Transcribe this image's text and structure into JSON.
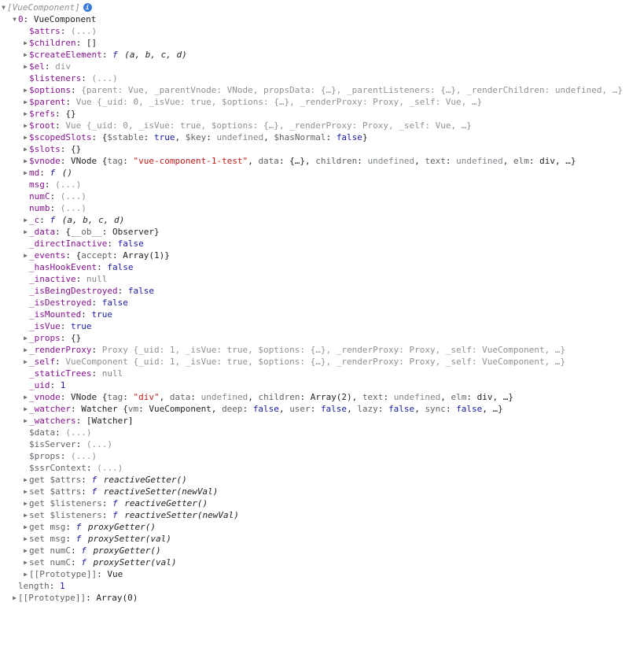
{
  "colors": {
    "key": "#881391",
    "num": "#1a1aa6",
    "str": "#c41a16",
    "undef": "#80868b",
    "dim": "#919191"
  },
  "lines": [
    {
      "indent": 0,
      "arrow": "down",
      "parts": [
        {
          "t": "italic v-dim",
          "v": "[VueComponent]"
        }
      ],
      "info": true
    },
    {
      "indent": 1,
      "arrow": "down",
      "parts": [
        {
          "t": "key",
          "v": "0"
        },
        {
          "t": "",
          "v": ": "
        },
        {
          "t": "cls",
          "v": "VueComponent"
        }
      ]
    },
    {
      "indent": 2,
      "arrow": "none",
      "parts": [
        {
          "t": "key",
          "v": "$attrs"
        },
        {
          "t": "",
          "v": ": "
        },
        {
          "t": "v-dim",
          "v": "(...)"
        }
      ]
    },
    {
      "indent": 2,
      "arrow": "right",
      "parts": [
        {
          "t": "key",
          "v": "$children"
        },
        {
          "t": "",
          "v": ": "
        },
        {
          "t": "cls",
          "v": "[]"
        }
      ]
    },
    {
      "indent": 2,
      "arrow": "right",
      "parts": [
        {
          "t": "key",
          "v": "$createElement"
        },
        {
          "t": "",
          "v": ": "
        },
        {
          "t": "f-letter",
          "v": "f"
        },
        {
          "t": "v-fn",
          "v": " (a, b, c, d)"
        }
      ]
    },
    {
      "indent": 2,
      "arrow": "right",
      "parts": [
        {
          "t": "key",
          "v": "$el"
        },
        {
          "t": "",
          "v": ": "
        },
        {
          "t": "v-dim",
          "v": "div"
        }
      ]
    },
    {
      "indent": 2,
      "arrow": "none",
      "parts": [
        {
          "t": "key",
          "v": "$listeners"
        },
        {
          "t": "",
          "v": ": "
        },
        {
          "t": "v-dim",
          "v": "(...)"
        }
      ]
    },
    {
      "indent": 2,
      "arrow": "right",
      "parts": [
        {
          "t": "key",
          "v": "$options"
        },
        {
          "t": "",
          "v": ": "
        },
        {
          "t": "v-dim",
          "v": "{parent: Vue, _parentVnode: VNode, propsData: {…}, _parentListeners: {…}, _renderChildren: undefined, …}"
        }
      ]
    },
    {
      "indent": 2,
      "arrow": "right",
      "parts": [
        {
          "t": "key",
          "v": "$parent"
        },
        {
          "t": "",
          "v": ": "
        },
        {
          "t": "v-dim",
          "v": "Vue {_uid: 0, _isVue: true, $options: {…}, _renderProxy: Proxy, _self: Vue, …}"
        }
      ]
    },
    {
      "indent": 2,
      "arrow": "right",
      "parts": [
        {
          "t": "key",
          "v": "$refs"
        },
        {
          "t": "",
          "v": ": "
        },
        {
          "t": "cls",
          "v": "{}"
        }
      ]
    },
    {
      "indent": 2,
      "arrow": "right",
      "parts": [
        {
          "t": "key",
          "v": "$root"
        },
        {
          "t": "",
          "v": ": "
        },
        {
          "t": "v-dim",
          "v": "Vue {_uid: 0, _isVue: true, $options: {…}, _renderProxy: Proxy, _self: Vue, …}"
        }
      ]
    },
    {
      "indent": 2,
      "arrow": "right",
      "parts": [
        {
          "t": "key",
          "v": "$scopedSlots"
        },
        {
          "t": "",
          "v": ": "
        },
        {
          "t": "brace",
          "v": "{"
        },
        {
          "t": "k-dim",
          "v": "$stable"
        },
        {
          "t": "",
          "v": ": "
        },
        {
          "t": "v-num",
          "v": "true"
        },
        {
          "t": "",
          "v": ", "
        },
        {
          "t": "k-dim",
          "v": "$key"
        },
        {
          "t": "",
          "v": ": "
        },
        {
          "t": "v-undef",
          "v": "undefined"
        },
        {
          "t": "",
          "v": ", "
        },
        {
          "t": "k-dim",
          "v": "$hasNormal"
        },
        {
          "t": "",
          "v": ": "
        },
        {
          "t": "v-num",
          "v": "false"
        },
        {
          "t": "brace",
          "v": "}"
        }
      ]
    },
    {
      "indent": 2,
      "arrow": "right",
      "parts": [
        {
          "t": "key",
          "v": "$slots"
        },
        {
          "t": "",
          "v": ": "
        },
        {
          "t": "cls",
          "v": "{}"
        }
      ]
    },
    {
      "indent": 2,
      "arrow": "right",
      "parts": [
        {
          "t": "key",
          "v": "$vnode"
        },
        {
          "t": "",
          "v": ": "
        },
        {
          "t": "cls",
          "v": "VNode {"
        },
        {
          "t": "k-dim",
          "v": "tag"
        },
        {
          "t": "",
          "v": ": "
        },
        {
          "t": "v-str",
          "v": "\"vue-component-1-test\""
        },
        {
          "t": "",
          "v": ", "
        },
        {
          "t": "k-dim",
          "v": "data"
        },
        {
          "t": "",
          "v": ": {…}, "
        },
        {
          "t": "k-dim",
          "v": "children"
        },
        {
          "t": "",
          "v": ": "
        },
        {
          "t": "v-undef",
          "v": "undefined"
        },
        {
          "t": "",
          "v": ", "
        },
        {
          "t": "k-dim",
          "v": "text"
        },
        {
          "t": "",
          "v": ": "
        },
        {
          "t": "v-undef",
          "v": "undefined"
        },
        {
          "t": "",
          "v": ", "
        },
        {
          "t": "k-dim",
          "v": "elm"
        },
        {
          "t": "",
          "v": ": div, …}"
        }
      ]
    },
    {
      "indent": 2,
      "arrow": "right",
      "parts": [
        {
          "t": "key",
          "v": "md"
        },
        {
          "t": "",
          "v": ": "
        },
        {
          "t": "f-letter",
          "v": "f"
        },
        {
          "t": "v-fn",
          "v": " ()"
        }
      ]
    },
    {
      "indent": 2,
      "arrow": "none",
      "parts": [
        {
          "t": "key",
          "v": "msg"
        },
        {
          "t": "",
          "v": ": "
        },
        {
          "t": "v-dim",
          "v": "(...)"
        }
      ]
    },
    {
      "indent": 2,
      "arrow": "none",
      "parts": [
        {
          "t": "key",
          "v": "numC"
        },
        {
          "t": "",
          "v": ": "
        },
        {
          "t": "v-dim",
          "v": "(...)"
        }
      ]
    },
    {
      "indent": 2,
      "arrow": "none",
      "parts": [
        {
          "t": "key",
          "v": "numb"
        },
        {
          "t": "",
          "v": ": "
        },
        {
          "t": "v-dim",
          "v": "(...)"
        }
      ]
    },
    {
      "indent": 2,
      "arrow": "right",
      "parts": [
        {
          "t": "key",
          "v": "_c"
        },
        {
          "t": "",
          "v": ": "
        },
        {
          "t": "f-letter",
          "v": "f"
        },
        {
          "t": "v-fn",
          "v": " (a, b, c, d)"
        }
      ]
    },
    {
      "indent": 2,
      "arrow": "right",
      "parts": [
        {
          "t": "key",
          "v": "_data"
        },
        {
          "t": "",
          "v": ": "
        },
        {
          "t": "brace",
          "v": "{"
        },
        {
          "t": "k-dim",
          "v": "__ob__"
        },
        {
          "t": "",
          "v": ": Observer"
        },
        {
          "t": "brace",
          "v": "}"
        }
      ]
    },
    {
      "indent": 2,
      "arrow": "none",
      "parts": [
        {
          "t": "key",
          "v": "_directInactive"
        },
        {
          "t": "",
          "v": ": "
        },
        {
          "t": "v-num",
          "v": "false"
        }
      ]
    },
    {
      "indent": 2,
      "arrow": "right",
      "parts": [
        {
          "t": "key",
          "v": "_events"
        },
        {
          "t": "",
          "v": ": "
        },
        {
          "t": "brace",
          "v": "{"
        },
        {
          "t": "k-dim",
          "v": "accept"
        },
        {
          "t": "",
          "v": ": Array(1)"
        },
        {
          "t": "brace",
          "v": "}"
        }
      ]
    },
    {
      "indent": 2,
      "arrow": "none",
      "parts": [
        {
          "t": "key",
          "v": "_hasHookEvent"
        },
        {
          "t": "",
          "v": ": "
        },
        {
          "t": "v-num",
          "v": "false"
        }
      ]
    },
    {
      "indent": 2,
      "arrow": "none",
      "parts": [
        {
          "t": "key",
          "v": "_inactive"
        },
        {
          "t": "",
          "v": ": "
        },
        {
          "t": "v-undef",
          "v": "null"
        }
      ]
    },
    {
      "indent": 2,
      "arrow": "none",
      "parts": [
        {
          "t": "key",
          "v": "_isBeingDestroyed"
        },
        {
          "t": "",
          "v": ": "
        },
        {
          "t": "v-num",
          "v": "false"
        }
      ]
    },
    {
      "indent": 2,
      "arrow": "none",
      "parts": [
        {
          "t": "key",
          "v": "_isDestroyed"
        },
        {
          "t": "",
          "v": ": "
        },
        {
          "t": "v-num",
          "v": "false"
        }
      ]
    },
    {
      "indent": 2,
      "arrow": "none",
      "parts": [
        {
          "t": "key",
          "v": "_isMounted"
        },
        {
          "t": "",
          "v": ": "
        },
        {
          "t": "v-num",
          "v": "true"
        }
      ]
    },
    {
      "indent": 2,
      "arrow": "none",
      "parts": [
        {
          "t": "key",
          "v": "_isVue"
        },
        {
          "t": "",
          "v": ": "
        },
        {
          "t": "v-num",
          "v": "true"
        }
      ]
    },
    {
      "indent": 2,
      "arrow": "right",
      "parts": [
        {
          "t": "key",
          "v": "_props"
        },
        {
          "t": "",
          "v": ": "
        },
        {
          "t": "cls",
          "v": "{}"
        }
      ]
    },
    {
      "indent": 2,
      "arrow": "right",
      "parts": [
        {
          "t": "key",
          "v": "_renderProxy"
        },
        {
          "t": "",
          "v": ": "
        },
        {
          "t": "v-dim",
          "v": "Proxy {_uid: 1, _isVue: true, $options: {…}, _renderProxy: Proxy, _self: VueComponent, …}"
        }
      ]
    },
    {
      "indent": 2,
      "arrow": "right",
      "parts": [
        {
          "t": "key",
          "v": "_self"
        },
        {
          "t": "",
          "v": ": "
        },
        {
          "t": "v-dim",
          "v": "VueComponent {_uid: 1, _isVue: true, $options: {…}, _renderProxy: Proxy, _self: VueComponent, …}"
        }
      ]
    },
    {
      "indent": 2,
      "arrow": "none",
      "parts": [
        {
          "t": "key",
          "v": "_staticTrees"
        },
        {
          "t": "",
          "v": ": "
        },
        {
          "t": "v-undef",
          "v": "null"
        }
      ]
    },
    {
      "indent": 2,
      "arrow": "none",
      "parts": [
        {
          "t": "key",
          "v": "_uid"
        },
        {
          "t": "",
          "v": ": "
        },
        {
          "t": "v-num",
          "v": "1"
        }
      ]
    },
    {
      "indent": 2,
      "arrow": "right",
      "parts": [
        {
          "t": "key",
          "v": "_vnode"
        },
        {
          "t": "",
          "v": ": "
        },
        {
          "t": "cls",
          "v": "VNode {"
        },
        {
          "t": "k-dim",
          "v": "tag"
        },
        {
          "t": "",
          "v": ": "
        },
        {
          "t": "v-str",
          "v": "\"div\""
        },
        {
          "t": "",
          "v": ", "
        },
        {
          "t": "k-dim",
          "v": "data"
        },
        {
          "t": "",
          "v": ": "
        },
        {
          "t": "v-undef",
          "v": "undefined"
        },
        {
          "t": "",
          "v": ", "
        },
        {
          "t": "k-dim",
          "v": "children"
        },
        {
          "t": "",
          "v": ": Array(2), "
        },
        {
          "t": "k-dim",
          "v": "text"
        },
        {
          "t": "",
          "v": ": "
        },
        {
          "t": "v-undef",
          "v": "undefined"
        },
        {
          "t": "",
          "v": ", "
        },
        {
          "t": "k-dim",
          "v": "elm"
        },
        {
          "t": "",
          "v": ": div, …}"
        }
      ]
    },
    {
      "indent": 2,
      "arrow": "right",
      "parts": [
        {
          "t": "key",
          "v": "_watcher"
        },
        {
          "t": "",
          "v": ": "
        },
        {
          "t": "cls",
          "v": "Watcher {"
        },
        {
          "t": "k-dim",
          "v": "vm"
        },
        {
          "t": "",
          "v": ": VueComponent, "
        },
        {
          "t": "k-dim",
          "v": "deep"
        },
        {
          "t": "",
          "v": ": "
        },
        {
          "t": "v-num",
          "v": "false"
        },
        {
          "t": "",
          "v": ", "
        },
        {
          "t": "k-dim",
          "v": "user"
        },
        {
          "t": "",
          "v": ": "
        },
        {
          "t": "v-num",
          "v": "false"
        },
        {
          "t": "",
          "v": ", "
        },
        {
          "t": "k-dim",
          "v": "lazy"
        },
        {
          "t": "",
          "v": ": "
        },
        {
          "t": "v-num",
          "v": "false"
        },
        {
          "t": "",
          "v": ", "
        },
        {
          "t": "k-dim",
          "v": "sync"
        },
        {
          "t": "",
          "v": ": "
        },
        {
          "t": "v-num",
          "v": "false"
        },
        {
          "t": "",
          "v": ", …}"
        }
      ]
    },
    {
      "indent": 2,
      "arrow": "right",
      "parts": [
        {
          "t": "key",
          "v": "_watchers"
        },
        {
          "t": "",
          "v": ": "
        },
        {
          "t": "cls",
          "v": "[Watcher]"
        }
      ]
    },
    {
      "indent": 2,
      "arrow": "none",
      "parts": [
        {
          "t": "k-dim",
          "v": "$data"
        },
        {
          "t": "",
          "v": ": "
        },
        {
          "t": "v-dim",
          "v": "(...)"
        }
      ]
    },
    {
      "indent": 2,
      "arrow": "none",
      "parts": [
        {
          "t": "k-dim",
          "v": "$isServer"
        },
        {
          "t": "",
          "v": ": "
        },
        {
          "t": "v-dim",
          "v": "(...)"
        }
      ]
    },
    {
      "indent": 2,
      "arrow": "none",
      "parts": [
        {
          "t": "k-dim",
          "v": "$props"
        },
        {
          "t": "",
          "v": ": "
        },
        {
          "t": "v-dim",
          "v": "(...)"
        }
      ]
    },
    {
      "indent": 2,
      "arrow": "none",
      "parts": [
        {
          "t": "k-dim",
          "v": "$ssrContext"
        },
        {
          "t": "",
          "v": ": "
        },
        {
          "t": "v-dim",
          "v": "(...)"
        }
      ]
    },
    {
      "indent": 2,
      "arrow": "right",
      "parts": [
        {
          "t": "k-dim",
          "v": "get $attrs"
        },
        {
          "t": "",
          "v": ": "
        },
        {
          "t": "f-letter",
          "v": "f"
        },
        {
          "t": "v-fn",
          "v": " reactiveGetter()"
        }
      ]
    },
    {
      "indent": 2,
      "arrow": "right",
      "parts": [
        {
          "t": "k-dim",
          "v": "set $attrs"
        },
        {
          "t": "",
          "v": ": "
        },
        {
          "t": "f-letter",
          "v": "f"
        },
        {
          "t": "v-fn",
          "v": " reactiveSetter(newVal)"
        }
      ]
    },
    {
      "indent": 2,
      "arrow": "right",
      "parts": [
        {
          "t": "k-dim",
          "v": "get $listeners"
        },
        {
          "t": "",
          "v": ": "
        },
        {
          "t": "f-letter",
          "v": "f"
        },
        {
          "t": "v-fn",
          "v": " reactiveGetter()"
        }
      ]
    },
    {
      "indent": 2,
      "arrow": "right",
      "parts": [
        {
          "t": "k-dim",
          "v": "set $listeners"
        },
        {
          "t": "",
          "v": ": "
        },
        {
          "t": "f-letter",
          "v": "f"
        },
        {
          "t": "v-fn",
          "v": " reactiveSetter(newVal)"
        }
      ]
    },
    {
      "indent": 2,
      "arrow": "right",
      "parts": [
        {
          "t": "k-dim",
          "v": "get msg"
        },
        {
          "t": "",
          "v": ": "
        },
        {
          "t": "f-letter",
          "v": "f"
        },
        {
          "t": "v-fn",
          "v": " proxyGetter()"
        }
      ]
    },
    {
      "indent": 2,
      "arrow": "right",
      "parts": [
        {
          "t": "k-dim",
          "v": "set msg"
        },
        {
          "t": "",
          "v": ": "
        },
        {
          "t": "f-letter",
          "v": "f"
        },
        {
          "t": "v-fn",
          "v": " proxySetter(val)"
        }
      ]
    },
    {
      "indent": 2,
      "arrow": "right",
      "parts": [
        {
          "t": "k-dim",
          "v": "get numC"
        },
        {
          "t": "",
          "v": ": "
        },
        {
          "t": "f-letter",
          "v": "f"
        },
        {
          "t": "v-fn",
          "v": " proxyGetter()"
        }
      ]
    },
    {
      "indent": 2,
      "arrow": "right",
      "parts": [
        {
          "t": "k-dim",
          "v": "set numC"
        },
        {
          "t": "",
          "v": ": "
        },
        {
          "t": "f-letter",
          "v": "f"
        },
        {
          "t": "v-fn",
          "v": " proxySetter(val)"
        }
      ]
    },
    {
      "indent": 2,
      "arrow": "right",
      "parts": [
        {
          "t": "k-dim",
          "v": "[[Prototype]]"
        },
        {
          "t": "",
          "v": ": "
        },
        {
          "t": "cls",
          "v": "Vue"
        }
      ]
    },
    {
      "indent": 1,
      "arrow": "none",
      "parts": [
        {
          "t": "k-dim",
          "v": "length"
        },
        {
          "t": "",
          "v": ": "
        },
        {
          "t": "v-num",
          "v": "1"
        }
      ]
    },
    {
      "indent": 1,
      "arrow": "right",
      "parts": [
        {
          "t": "k-dim",
          "v": "[[Prototype]]"
        },
        {
          "t": "",
          "v": ": "
        },
        {
          "t": "cls",
          "v": "Array(0)"
        }
      ]
    }
  ]
}
